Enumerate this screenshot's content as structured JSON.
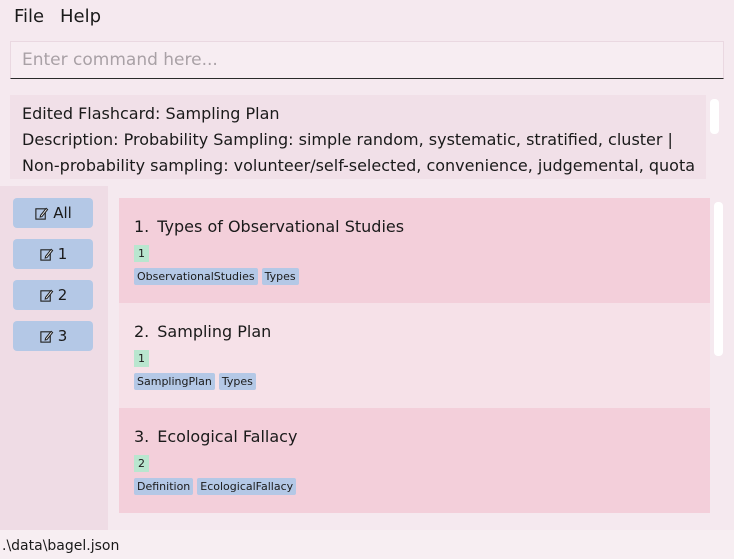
{
  "menu": {
    "file": "File",
    "help": "Help"
  },
  "command": {
    "placeholder": "Enter command here...",
    "value": ""
  },
  "result": {
    "line1": "Edited Flashcard: Sampling Plan",
    "line2": "Description: Probability Sampling: simple random, systematic, stratified, cluster |",
    "line3": "Non-probability sampling: volunteer/self-selected, convenience, judgemental, quota"
  },
  "tag_buttons": [
    {
      "label": "All",
      "icon": "edit-icon"
    },
    {
      "label": "1",
      "icon": "edit-icon"
    },
    {
      "label": "2",
      "icon": "edit-icon"
    },
    {
      "label": "3",
      "icon": "edit-icon"
    }
  ],
  "flashcards": [
    {
      "index": "1.",
      "title": "Types of Observational Studies",
      "count": "1",
      "tags": [
        "ObservationalStudies",
        "Types"
      ]
    },
    {
      "index": "2.",
      "title": "Sampling Plan",
      "count": "1",
      "tags": [
        "SamplingPlan",
        "Types"
      ]
    },
    {
      "index": "3.",
      "title": "Ecological Fallacy",
      "count": "2",
      "tags": [
        "Definition",
        "EcologicalFallacy"
      ]
    }
  ],
  "status": {
    "path": ".\\data\\bagel.json"
  },
  "colors": {
    "background": "#f5e9ef",
    "card_odd": "#f3cfda",
    "card_even": "#f6e1e8",
    "tag": "#b4c8e6",
    "count_badge": "#b9e6cf"
  }
}
